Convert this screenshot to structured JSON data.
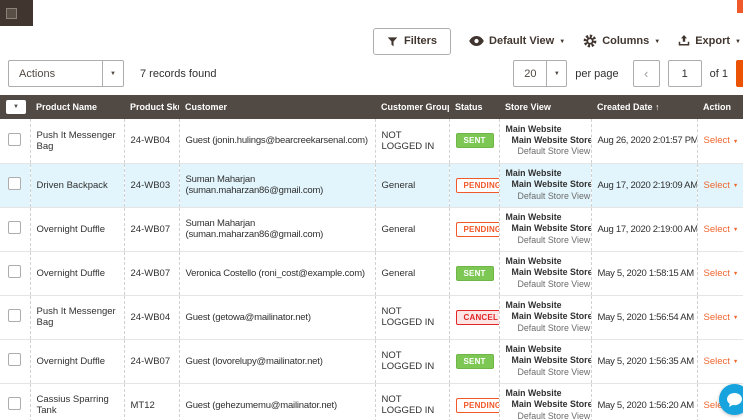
{
  "toolbar": {
    "filters": "Filters",
    "default_view": "Default View",
    "columns": "Columns",
    "export": "Export"
  },
  "controls": {
    "actions": "Actions",
    "records": "7 records found",
    "per_page": "20",
    "per_page_label": "per page",
    "prev": "‹",
    "next": "›",
    "page": "1",
    "of_label": "of 1"
  },
  "table": {
    "headers": [
      "Product Name",
      "Product Sku",
      "Customer",
      "Customer Group",
      "Status",
      "Store View",
      "Created Date",
      "Action"
    ],
    "sort_indicator": "↑",
    "rows": [
      {
        "product_name": "Push It Messenger Bag",
        "sku": "24-WB04",
        "customer": "Guest (jonin.hulings@bearcreekarsenal.com)",
        "group": "NOT LOGGED IN",
        "status": "SENT",
        "status_type": "sent",
        "store_lines": [
          "Main Website",
          "Main Website Store",
          "Default Store View"
        ],
        "created": "Aug 26, 2020 2:01:57 PM",
        "action": "Select"
      },
      {
        "product_name": "Driven Backpack",
        "sku": "24-WB03",
        "customer": "Suman Maharjan (suman.maharzan86@gmail.com)",
        "group": "General",
        "status": "PENDING",
        "status_type": "pending",
        "store_lines": [
          "Main Website",
          "Main Website Store",
          "Default Store View"
        ],
        "created": "Aug 17, 2020 2:19:09 AM",
        "action": "Select"
      },
      {
        "product_name": "Overnight Duffle",
        "sku": "24-WB07",
        "customer": "Suman Maharjan (suman.maharzan86@gmail.com)",
        "group": "General",
        "status": "PENDING",
        "status_type": "pending",
        "store_lines": [
          "Main Website",
          "Main Website Store",
          "Default Store View"
        ],
        "created": "Aug 17, 2020 2:19:00 AM",
        "action": "Select"
      },
      {
        "product_name": "Overnight Duffle",
        "sku": "24-WB07",
        "customer": "Veronica Costello (roni_cost@example.com)",
        "group": "General",
        "status": "SENT",
        "status_type": "sent",
        "store_lines": [
          "Main Website",
          "Main Website Store",
          "Default Store View"
        ],
        "created": "May 5, 2020 1:58:15 AM",
        "action": "Select"
      },
      {
        "product_name": "Push It Messenger Bag",
        "sku": "24-WB04",
        "customer": "Guest (getowa@mailinator.net)",
        "group": "NOT LOGGED IN",
        "status": "CANCEL",
        "status_type": "cancel",
        "store_lines": [
          "Main Website",
          "Main Website Store",
          "Default Store View"
        ],
        "created": "May 5, 2020 1:56:54 AM",
        "action": "Select"
      },
      {
        "product_name": "Overnight Duffle",
        "sku": "24-WB07",
        "customer": "Guest (lovorelupy@mailinator.net)",
        "group": "NOT LOGGED IN",
        "status": "SENT",
        "status_type": "sent",
        "store_lines": [
          "Main Website",
          "Main Website Store",
          "Default Store View"
        ],
        "created": "May 5, 2020 1:56:35 AM",
        "action": "Select"
      },
      {
        "product_name": "Cassius Sparring Tank",
        "sku": "MT12",
        "customer": "Guest (gehezumemu@mailinator.net)",
        "group": "NOT LOGGED IN",
        "status": "PENDING",
        "status_type": "pending",
        "store_lines": [
          "Main Website",
          "Main Website Store",
          "Default Store View"
        ],
        "created": "May 5, 2020 1:56:20 AM",
        "action": "Select"
      }
    ]
  },
  "colors": {
    "accent_orange": "#eb5202",
    "grid_header_bg": "#514943",
    "status_sent": "#7dc855",
    "status_pending": "#f0592a",
    "status_cancel": "#e22626",
    "row_highlight": "#e2f5fc",
    "chat_blue": "#17a3dd"
  }
}
